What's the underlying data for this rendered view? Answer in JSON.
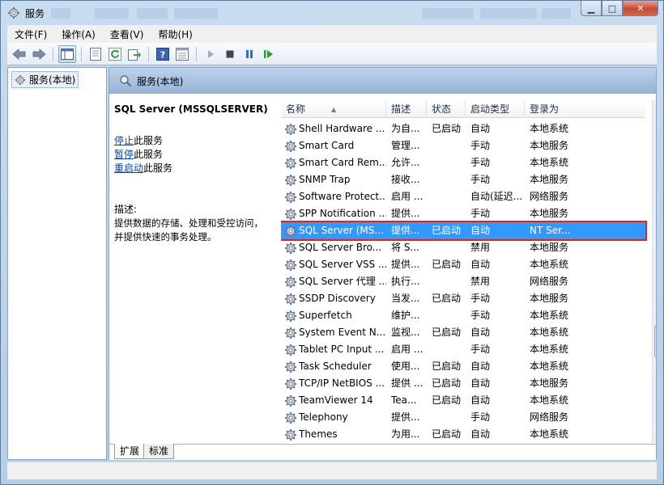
{
  "window": {
    "title": "服务",
    "controls": {
      "minimize": "▁",
      "maximize": "□",
      "close": "✕"
    }
  },
  "menu": [
    {
      "label": "文件(F)"
    },
    {
      "label": "操作(A)"
    },
    {
      "label": "查看(V)"
    },
    {
      "label": "帮助(H)"
    }
  ],
  "toolbar": {
    "icons": [
      "back-icon",
      "forward-icon",
      "console-tree-icon",
      "properties-icon",
      "refresh-icon",
      "export-icon",
      "help-icon",
      "details-view-icon",
      "start-service-icon",
      "stop-service-icon",
      "pause-service-icon",
      "restart-service-icon"
    ]
  },
  "tree": {
    "root_label": "服务(本地)"
  },
  "pane": {
    "header_title": "服务(本地)"
  },
  "details": {
    "service_title": "SQL Server (MSSQLSERVER)",
    "actions": [
      {
        "link": "停止",
        "suffix": "此服务"
      },
      {
        "link": "暂停",
        "suffix": "此服务"
      },
      {
        "link": "重启动",
        "suffix": "此服务"
      }
    ],
    "desc_label": "描述:",
    "desc_lines": [
      "提供数据的存储、处理和受控访问，",
      "并提供快速的事务处理。"
    ]
  },
  "columns": {
    "name": "名称",
    "desc": "描述",
    "status": "状态",
    "startup": "启动类型",
    "logon": "登录为"
  },
  "rows": [
    {
      "name": "Shell Hardware ...",
      "desc": "为自...",
      "status": "已启动",
      "startup": "自动",
      "logon": "本地系统"
    },
    {
      "name": "Smart Card",
      "desc": "管理...",
      "status": "",
      "startup": "手动",
      "logon": "本地服务"
    },
    {
      "name": "Smart Card Rem...",
      "desc": "允许...",
      "status": "",
      "startup": "手动",
      "logon": "本地系统"
    },
    {
      "name": "SNMP Trap",
      "desc": "接收...",
      "status": "",
      "startup": "手动",
      "logon": "本地服务"
    },
    {
      "name": "Software Protect...",
      "desc": "启用 ...",
      "status": "",
      "startup": "自动(延迟...",
      "logon": "网络服务"
    },
    {
      "name": "SPP Notification ...",
      "desc": "提供...",
      "status": "",
      "startup": "手动",
      "logon": "本地服务"
    },
    {
      "name": "SQL Server (MS...",
      "desc": "提供...",
      "status": "已启动",
      "startup": "自动",
      "logon": "NT Ser...",
      "selected": true
    },
    {
      "name": "SQL Server Bro...",
      "desc": "将 S...",
      "status": "",
      "startup": "禁用",
      "logon": "本地服务"
    },
    {
      "name": "SQL Server VSS ...",
      "desc": "提供...",
      "status": "已启动",
      "startup": "自动",
      "logon": "本地系统"
    },
    {
      "name": "SQL Server 代理 ...",
      "desc": "执行...",
      "status": "",
      "startup": "禁用",
      "logon": "网络服务"
    },
    {
      "name": "SSDP Discovery",
      "desc": "当发...",
      "status": "已启动",
      "startup": "手动",
      "logon": "本地服务"
    },
    {
      "name": "Superfetch",
      "desc": "维护...",
      "status": "",
      "startup": "手动",
      "logon": "本地系统"
    },
    {
      "name": "System Event N...",
      "desc": "监视...",
      "status": "已启动",
      "startup": "自动",
      "logon": "本地系统"
    },
    {
      "name": "Tablet PC Input ...",
      "desc": "启用 ...",
      "status": "",
      "startup": "手动",
      "logon": "本地系统"
    },
    {
      "name": "Task Scheduler",
      "desc": "使用...",
      "status": "已启动",
      "startup": "自动",
      "logon": "本地系统"
    },
    {
      "name": "TCP/IP NetBIOS ...",
      "desc": "提供 ...",
      "status": "已启动",
      "startup": "自动",
      "logon": "本地服务"
    },
    {
      "name": "TeamViewer 14",
      "desc": "Tea...",
      "status": "已启动",
      "startup": "自动",
      "logon": "本地系统"
    },
    {
      "name": "Telephony",
      "desc": "提供...",
      "status": "",
      "startup": "手动",
      "logon": "网络服务"
    },
    {
      "name": "Themes",
      "desc": "为用...",
      "status": "已启动",
      "startup": "自动",
      "logon": "本地系统"
    }
  ],
  "tabs": [
    {
      "label": "扩展",
      "active": true
    },
    {
      "label": "标准",
      "active": false
    }
  ],
  "colors": {
    "selection": "#3399ff",
    "highlight_border": "#e0241c",
    "link": "#0645ad"
  }
}
